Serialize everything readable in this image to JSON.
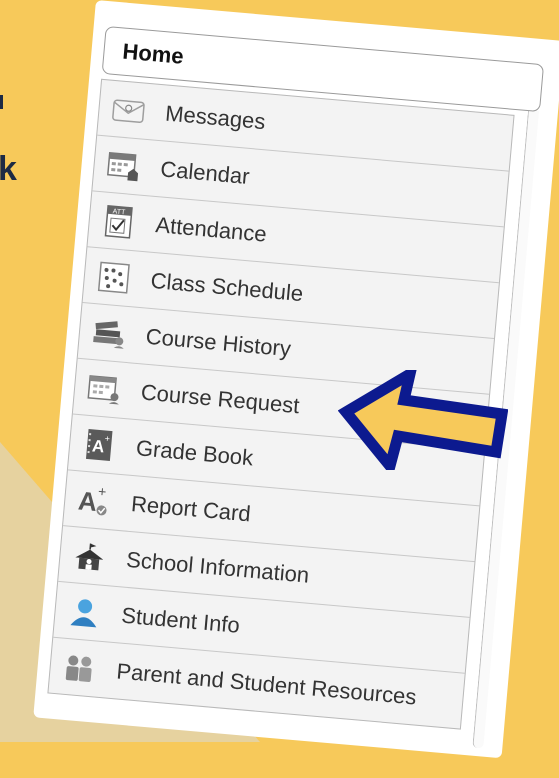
{
  "page": {
    "partial_heading": "k"
  },
  "nav": {
    "home_label": "Home",
    "items": [
      {
        "label": "Messages",
        "icon": "envelope-icon"
      },
      {
        "label": "Calendar",
        "icon": "calendar-icon"
      },
      {
        "label": "Attendance",
        "icon": "attendance-icon"
      },
      {
        "label": "Class Schedule",
        "icon": "schedule-grid-icon"
      },
      {
        "label": "Course History",
        "icon": "books-icon"
      },
      {
        "label": "Course Request",
        "icon": "course-request-icon"
      },
      {
        "label": "Grade Book",
        "icon": "gradebook-icon"
      },
      {
        "label": "Report Card",
        "icon": "report-card-icon"
      },
      {
        "label": "School Information",
        "icon": "school-house-icon"
      },
      {
        "label": "Student Info",
        "icon": "student-icon"
      },
      {
        "label": "Parent and Student Resources",
        "icon": "people-icon"
      }
    ]
  },
  "colors": {
    "background": "#f7c95a",
    "arrow": "#0c1a8f",
    "text_dark": "#1d2a44"
  }
}
